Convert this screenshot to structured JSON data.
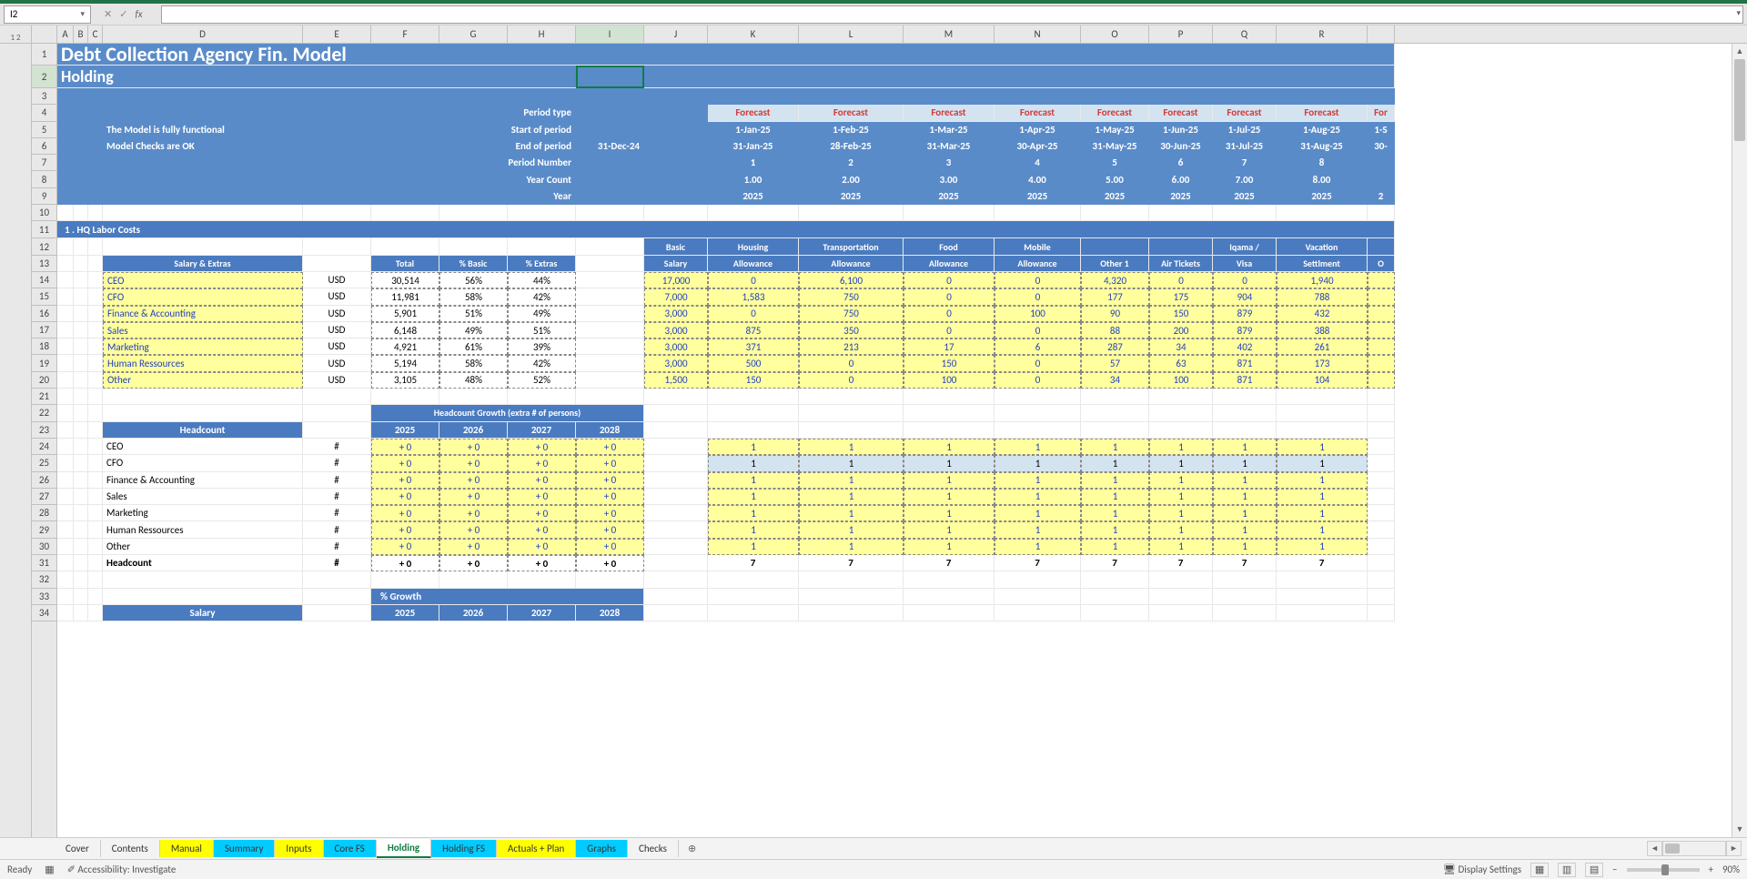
{
  "namebox": "I2",
  "title": "Debt Collection Agency Fin. Model",
  "subtitle": "Holding",
  "status_lines": [
    "The Model is fully functional",
    "Model Checks are OK"
  ],
  "period_labels": [
    "Period type",
    "Start of period",
    "End of period",
    "Period Number",
    "Year Count",
    "Year"
  ],
  "forecast_label": "Forecast",
  "forecast_trunc": "For",
  "i_end": "31-Dec-24",
  "cols": [
    "A",
    "B",
    "C",
    "D",
    "E",
    "F",
    "G",
    "H",
    "I",
    "J",
    "K",
    "L",
    "M",
    "N",
    "O",
    "P",
    "Q",
    "R"
  ],
  "periods": {
    "start": [
      "1-Jan-25",
      "1-Feb-25",
      "1-Mar-25",
      "1-Apr-25",
      "1-May-25",
      "1-Jun-25",
      "1-Jul-25",
      "1-Aug-25",
      "1-S"
    ],
    "end": [
      "31-Jan-25",
      "28-Feb-25",
      "31-Mar-25",
      "30-Apr-25",
      "31-May-25",
      "30-Jun-25",
      "31-Jul-25",
      "31-Aug-25",
      "30-"
    ],
    "num": [
      "1",
      "2",
      "3",
      "4",
      "5",
      "6",
      "7",
      "8",
      ""
    ],
    "yc": [
      "1.00",
      "2.00",
      "3.00",
      "4.00",
      "5.00",
      "6.00",
      "7.00",
      "8.00",
      ""
    ],
    "year": [
      "2025",
      "2025",
      "2025",
      "2025",
      "2025",
      "2025",
      "2025",
      "2025",
      "2"
    ]
  },
  "section1": "1 . HQ Labor Costs",
  "salary_extras_hdr": "Salary & Extras",
  "cols_fgh": [
    "Total",
    "% Basic",
    "% Extras"
  ],
  "usd": "USD",
  "roles": [
    "CEO",
    "CFO",
    "Finance & Accounting",
    "Sales",
    "Marketing",
    "Human Ressources",
    "Other"
  ],
  "salary_data": [
    {
      "total": "30,514",
      "basic": "56%",
      "extras": "44%"
    },
    {
      "total": "11,981",
      "basic": "58%",
      "extras": "42%"
    },
    {
      "total": "5,901",
      "basic": "51%",
      "extras": "49%"
    },
    {
      "total": "6,148",
      "basic": "49%",
      "extras": "51%"
    },
    {
      "total": "4,921",
      "basic": "61%",
      "extras": "39%"
    },
    {
      "total": "5,194",
      "basic": "58%",
      "extras": "42%"
    },
    {
      "total": "3,105",
      "basic": "48%",
      "extras": "52%"
    }
  ],
  "alloc_hdrs": [
    "Basic Salary",
    "Housing Allowance",
    "Transportation Allowance",
    "Food Allowance",
    "Mobile Allowance",
    "Other 1",
    "Air Tickets",
    "Iqama / Visa",
    "Vacation Settlment",
    "O"
  ],
  "alloc_rows": [
    [
      "17,000",
      "0",
      "6,100",
      "0",
      "0",
      "4,320",
      "0",
      "0",
      "1,940"
    ],
    [
      "7,000",
      "1,583",
      "750",
      "0",
      "0",
      "177",
      "175",
      "904",
      "788"
    ],
    [
      "3,000",
      "0",
      "750",
      "0",
      "100",
      "90",
      "150",
      "879",
      "432"
    ],
    [
      "3,000",
      "875",
      "350",
      "0",
      "0",
      "88",
      "200",
      "879",
      "388"
    ],
    [
      "3,000",
      "371",
      "213",
      "17",
      "6",
      "287",
      "34",
      "402",
      "261"
    ],
    [
      "3,000",
      "500",
      "0",
      "150",
      "0",
      "57",
      "63",
      "871",
      "173"
    ],
    [
      "1,500",
      "150",
      "0",
      "100",
      "0",
      "34",
      "100",
      "871",
      "104"
    ]
  ],
  "headcount_hdr": "Headcount",
  "hc_growth_hdr": "Headcount Growth (extra # of persons)",
  "years": [
    "2025",
    "2026",
    "2027",
    "2028"
  ],
  "hash": "#",
  "plus0": "+ 0",
  "hc_rows_labels": [
    "CEO",
    "CFO",
    "Finance & Accounting",
    "Sales",
    "Marketing",
    "Human Ressources",
    "Other"
  ],
  "hc_total_label": "Headcount",
  "hc_forecast_one": "1",
  "hc_forecast_total": "7",
  "pct_growth_hdr": "% Growth",
  "salary_hdr2": "Salary",
  "tabs": [
    "Cover",
    "Contents",
    "Manual",
    "Summary",
    "Inputs",
    "Core FS",
    "Holding",
    "Holding FS",
    "Actuals + Plan",
    "Graphs",
    "Checks"
  ],
  "status": {
    "ready": "Ready",
    "acc": "Accessibility: Investigate",
    "disp": "Display Settings",
    "zoom": "90%"
  }
}
